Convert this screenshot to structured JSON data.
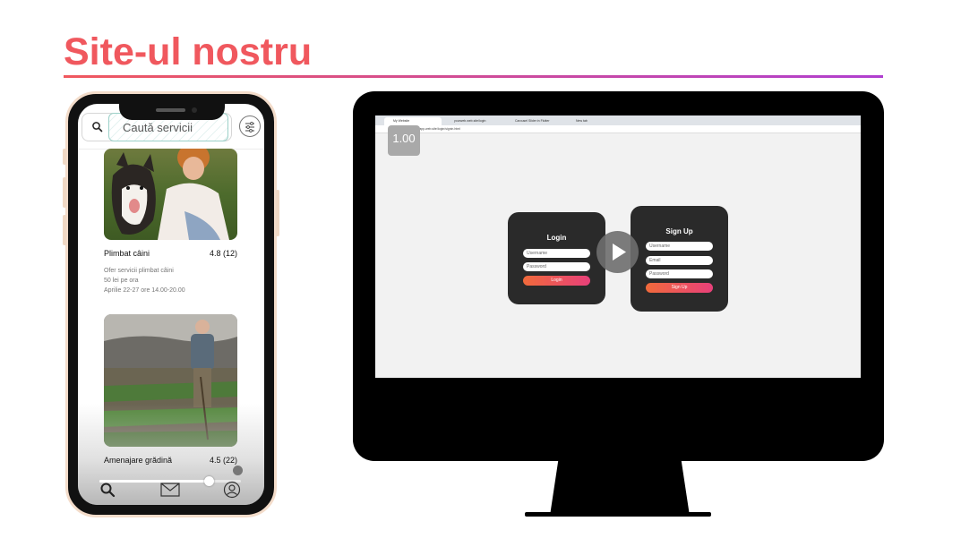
{
  "slide": {
    "title": "Site-ul nostru",
    "title_color": "#f0585e",
    "rule_gradient": [
      "#f0585e",
      "#b03fd0"
    ]
  },
  "phone": {
    "search": {
      "placeholder": "Caută servicii"
    },
    "cards": [
      {
        "title": "Plimbat câini",
        "rating": "4.8 (12)",
        "description": [
          "Ofer servicii plimbat câini",
          "50 lei pe ora",
          "Aprilie 22-27 ore 14.00-20.00"
        ]
      },
      {
        "title": "Amenajare grădină",
        "rating": "4.5 (22)",
        "description": []
      }
    ],
    "tabbar": [
      "search-icon",
      "mail-icon",
      "profile-icon"
    ],
    "video_progress": 0.77
  },
  "monitor": {
    "browser": {
      "tabs": [
        "My Website",
        "yourweb.web.site/login",
        "Carousel Slider in Flutter",
        "New tab"
      ],
      "url": "yourwebapp.web.site/login/signin.html"
    },
    "zoom_badge": "1.00",
    "login": {
      "title": "Login",
      "username_placeholder": "Username",
      "password_placeholder": "Password",
      "button": "Login"
    },
    "signup": {
      "title": "Sign Up",
      "username_placeholder": "Username",
      "email_placeholder": "Email",
      "password_placeholder": "Password",
      "button": "Sign Up"
    },
    "accent_gradient": [
      "#f06a3b",
      "#e8407a"
    ]
  }
}
